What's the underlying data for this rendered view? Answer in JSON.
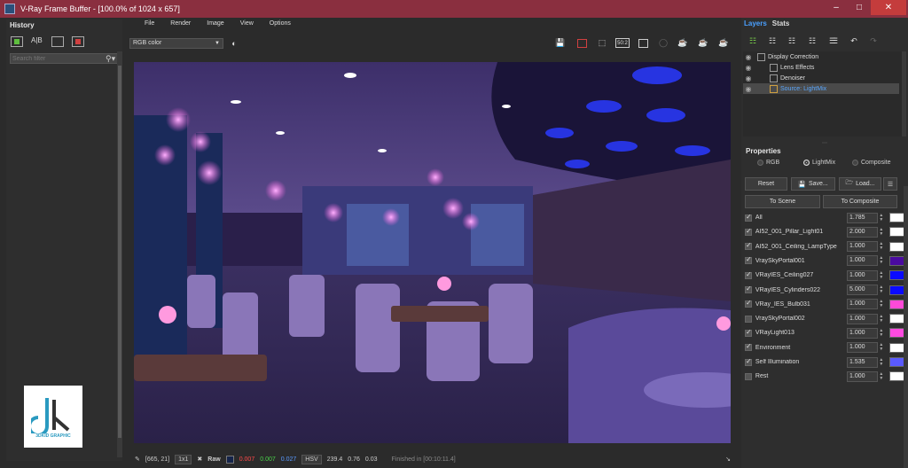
{
  "window": {
    "title": "V-Ray Frame Buffer - [100.0% of 1024 x 657]"
  },
  "history": {
    "header": "History",
    "search_placeholder": "Search filter"
  },
  "menu": [
    "File",
    "Render",
    "Image",
    "View",
    "Options"
  ],
  "toolbar": {
    "channel": "RGB color",
    "zoom_icon_label": "50:2"
  },
  "status": {
    "coords": "[665, 21]",
    "zoom": "1x1",
    "mode": "Raw",
    "r": "0.007",
    "g": "0.007",
    "b": "0.027",
    "color_space": "HSV",
    "h": "239.4",
    "s": "0.76",
    "v": "0.03",
    "message": "Finished in [00:10:11.4]"
  },
  "panel": {
    "tabs": [
      "Layers",
      "Stats"
    ],
    "layers": [
      {
        "name": "Display Correction",
        "selected": false
      },
      {
        "name": "Lens Effects",
        "selected": false
      },
      {
        "name": "Denoiser",
        "selected": false
      },
      {
        "name": "Source: LightMix",
        "selected": true
      }
    ],
    "properties_header": "Properties",
    "modes": [
      "RGB",
      "LightMix",
      "Composite"
    ],
    "active_mode": "LightMix",
    "buttons": {
      "reset": "Reset",
      "save": "Save...",
      "load": "Load...",
      "to_scene": "To Scene",
      "to_composite": "To Composite"
    },
    "lights": [
      {
        "name": "All",
        "value": "1.785",
        "checked": true,
        "color": "#ffffff"
      },
      {
        "name": "AI52_001_Pillar_Light01",
        "value": "2.000",
        "checked": true,
        "color": "#ffffff"
      },
      {
        "name": "AI52_001_Ceiling_LampType",
        "value": "1.000",
        "checked": true,
        "color": "#ffffff"
      },
      {
        "name": "VraySkyPortal001",
        "value": "1.000",
        "checked": true,
        "color": "#4a0aa0"
      },
      {
        "name": "VRayIES_Ceiling027",
        "value": "1.000",
        "checked": true,
        "color": "#0a0aff"
      },
      {
        "name": "VRayIES_Cylinders022",
        "value": "5.000",
        "checked": true,
        "color": "#0a0aff"
      },
      {
        "name": "VRay_IES_Bulb031",
        "value": "1.000",
        "checked": true,
        "color": "#ff4ad8"
      },
      {
        "name": "VraySkyPortal002",
        "value": "1.000",
        "checked": false,
        "color": "#ffffff"
      },
      {
        "name": "VRayLight013",
        "value": "1.000",
        "checked": true,
        "color": "#ff4ae0"
      },
      {
        "name": "Environment",
        "value": "1.000",
        "checked": true,
        "color": "#ffffff"
      },
      {
        "name": "Self Illumination",
        "value": "1.535",
        "checked": true,
        "color": "#5a5aff"
      },
      {
        "name": "Rest",
        "value": "1.000",
        "checked": false,
        "color": "#ffffff"
      }
    ]
  },
  "logo": {
    "text": "3DKID GRAPHIC"
  }
}
